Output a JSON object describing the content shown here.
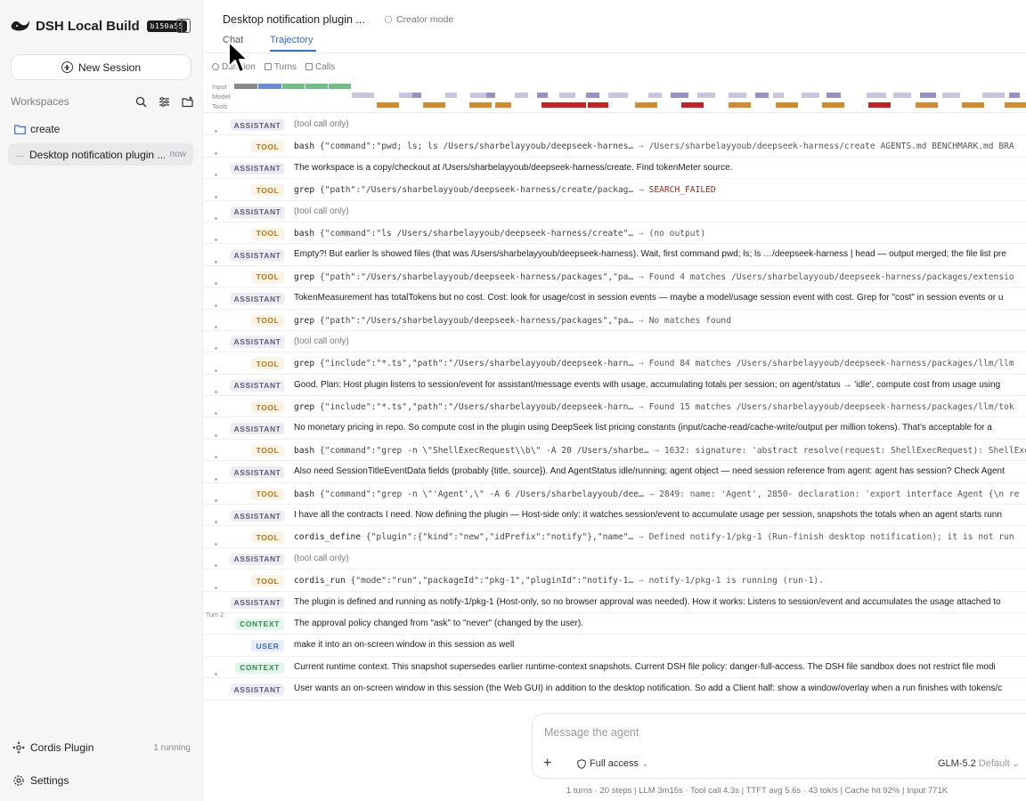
{
  "app": {
    "name": "DSH Local Build",
    "build": "b150a55"
  },
  "sidebar": {
    "new_session": "New Session",
    "workspaces_label": "Workspaces",
    "workspace": "create",
    "session": {
      "title": "Desktop notification plugin ...",
      "time": "now"
    },
    "plugin": {
      "label": "Cordis Plugin",
      "status": "1 running"
    },
    "settings": "Settings"
  },
  "header": {
    "title": "Desktop notification plugin ...",
    "creator_mode": "Creator mode",
    "tabs": [
      "Chat",
      "Trajectory"
    ]
  },
  "subtabs": [
    "Duration",
    "Turns",
    "Calls"
  ],
  "timeline": {
    "labels": [
      "Input",
      "Model",
      "Tools"
    ]
  },
  "rows": [
    {
      "type": "assistant",
      "badge": "ASSISTANT",
      "text": "(tool call only)",
      "muted": true
    },
    {
      "type": "tool",
      "badge": "TOOL",
      "name": "bash",
      "args": "{\"command\":\"pwd; ls; ls /Users/sharbelayyoub/deepseek-harnes…",
      "result": "/Users/sharbelayyoub/deepseek-harness/create AGENTS.md BENCHMARK.md BRA"
    },
    {
      "type": "assistant",
      "badge": "ASSISTANT",
      "text": "The workspace is a copy/checkout at /Users/sharbelayyoub/deepseek-harness/create. Find tokenMeter source."
    },
    {
      "type": "tool",
      "badge": "TOOL",
      "name": "grep",
      "args": "{\"path\":\"/Users/sharbelayyoub/deepseek-harness/create/packag…",
      "result": "SEARCH_FAILED",
      "fail": true
    },
    {
      "type": "assistant",
      "badge": "ASSISTANT",
      "text": "(tool call only)",
      "muted": true
    },
    {
      "type": "tool",
      "badge": "TOOL",
      "name": "bash",
      "args": "{\"command\":\"ls /Users/sharbelayyoub/deepseek-harness/create\"…",
      "result": "(no output)"
    },
    {
      "type": "assistant",
      "badge": "ASSISTANT",
      "text": "Empty?! But earlier ls showed files (that was /Users/sharbelayyoub/deepseek-harness). Wait, first command pwd; ls; ls …/deepseek-harness | head — output merged; the file list pre"
    },
    {
      "type": "tool",
      "badge": "TOOL",
      "name": "grep",
      "args": "{\"path\":\"/Users/sharbelayyoub/deepseek-harness/packages\",\"pa…",
      "result": "Found 4 matches /Users/sharbelayyoub/deepseek-harness/packages/extensio"
    },
    {
      "type": "assistant",
      "badge": "ASSISTANT",
      "text": "TokenMeasurement has totalTokens but no cost. Cost: look for usage/cost in session events — maybe a model/usage session event with cost. Grep for \"cost\" in session events or u"
    },
    {
      "type": "tool",
      "badge": "TOOL",
      "name": "grep",
      "args": "{\"path\":\"/Users/sharbelayyoub/deepseek-harness/packages\",\"pa…",
      "result": "No matches found"
    },
    {
      "type": "assistant",
      "badge": "ASSISTANT",
      "text": "(tool call only)",
      "muted": true
    },
    {
      "type": "tool",
      "badge": "TOOL",
      "name": "grep",
      "args": "{\"include\":\"*.ts\",\"path\":\"/Users/sharbelayyoub/deepseek-harn…",
      "result": "Found 84 matches /Users/sharbelayyoub/deepseek-harness/packages/llm/llm"
    },
    {
      "type": "assistant",
      "badge": "ASSISTANT",
      "text": "Good. Plan: Host plugin listens to session/event for assistant/message events with usage, accumulating totals per session; on agent/status → 'idle', compute cost from usage using"
    },
    {
      "type": "tool",
      "badge": "TOOL",
      "name": "grep",
      "args": "{\"include\":\"*.ts\",\"path\":\"/Users/sharbelayyoub/deepseek-harn…",
      "result": "Found 15 matches /Users/sharbelayyoub/deepseek-harness/packages/llm/tok"
    },
    {
      "type": "assistant",
      "badge": "ASSISTANT",
      "text": "No monetary pricing in repo. So compute cost in the plugin using DeepSeek list pricing constants (input/cache-read/cache-write/output per million tokens). That's acceptable for a"
    },
    {
      "type": "tool",
      "badge": "TOOL",
      "name": "bash",
      "args": "{\"command\":\"grep -n \\\"ShellExecRequest\\\\b\\\" -A 20 /Users/sharbe…",
      "result": "1632: signature: 'abstract resolve(request: ShellExecRequest): ShellExe"
    },
    {
      "type": "assistant",
      "badge": "ASSISTANT",
      "text": "Also need SessionTitleEventData fields (probably {title, source}). And AgentStatus idle/running; agent object — need session reference from agent: agent has session? Check Agent"
    },
    {
      "type": "tool",
      "badge": "TOOL",
      "name": "bash",
      "args": "{\"command\":\"grep -n \\\"'Agent',\\\" -A 6 /Users/sharbelayyoub/dee…",
      "result": "2849: name: 'Agent', 2850- declaration: 'export interface Agent {\\n re"
    },
    {
      "type": "assistant",
      "badge": "ASSISTANT",
      "text": "I have all the contracts I need. Now defining the plugin — Host-side only: it watches session/event to accumulate usage per session, snapshots the totals when an agent starts runn"
    },
    {
      "type": "tool",
      "badge": "TOOL",
      "name": "cordis_define",
      "args": "{\"plugin\":{\"kind\":\"new\",\"idPrefix\":\"notify\"},\"name\"…",
      "result": "Defined notify-1/pkg-1 (Run-finish desktop notification); it is not run"
    },
    {
      "type": "assistant",
      "badge": "ASSISTANT",
      "text": "(tool call only)",
      "muted": true
    },
    {
      "type": "tool",
      "badge": "TOOL",
      "name": "cordis_run",
      "args": "{\"mode\":\"run\",\"packageId\":\"pkg-1\",\"pluginId\":\"notify-1…",
      "result": "notify-1/pkg-1 is running (run-1)."
    },
    {
      "type": "assistant",
      "badge": "ASSISTANT",
      "text": "The plugin is defined and running as notify-1/pkg-1 (Host-only, so no browser approval was needed). How it works: Listens to session/event and accumulates the usage attached to"
    },
    {
      "type": "context",
      "badge": "CONTEXT",
      "text": "The approval policy changed from \"ask\" to \"never\" (changed by the user).",
      "turn": "Turn 2"
    },
    {
      "type": "user",
      "badge": "USER",
      "text": "make it into an on-screen window in this session as well"
    },
    {
      "type": "context",
      "badge": "CONTEXT",
      "text": "Current runtime context. This snapshot supersedes earlier runtime-context snapshots. Current DSH file policy: danger-full-access. The DSH file sandbox does not restrict file modi"
    },
    {
      "type": "assistant",
      "badge": "ASSISTANT",
      "text": "User wants an on-screen window in this session (the Web GUI) in addition to the desktop notification. So add a Client half: show a window/overlay when a run finishes with tokens/c"
    }
  ],
  "composer": {
    "placeholder": "Message the agent",
    "access": "Full access",
    "model": "GLM-5.2",
    "model_tag": "Default"
  },
  "stats": "1 turns · 20 steps  |  LLM 3m15s · Tool call 4.3s  |  TTFT avg 5.6s · 43 tok/s  |  Cache hit 92%  |  Input 771K",
  "colors": {
    "accent": "#2d6cdf",
    "tool": "#b07716",
    "assistant": "#5c5c78",
    "context": "#2e8b52",
    "user": "#3b6bd1"
  }
}
